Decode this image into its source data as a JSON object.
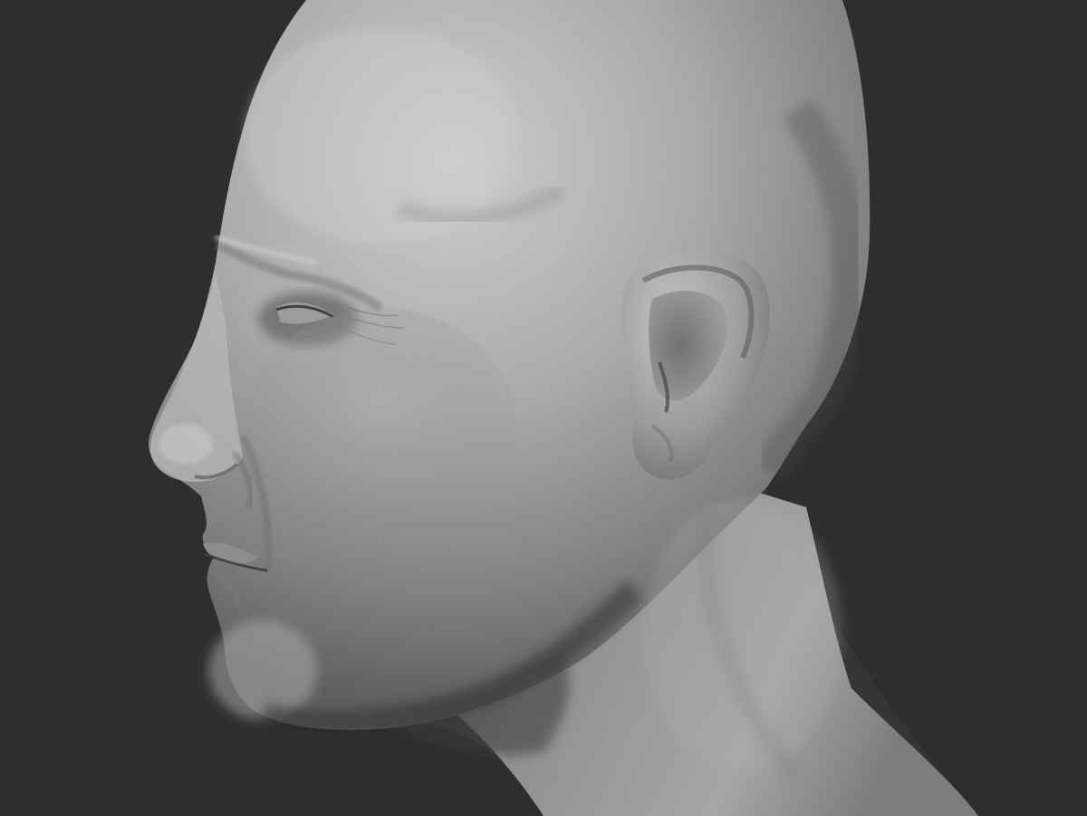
{
  "scene": {
    "subject": "sculpted-male-head-profile",
    "colors": {
      "background": "#2e2e2e",
      "clay_light": "#c9c9c9",
      "clay_mid": "#8f8f8f",
      "clay_dark": "#3c3c3c",
      "shadow": "#1f1f1f"
    }
  }
}
